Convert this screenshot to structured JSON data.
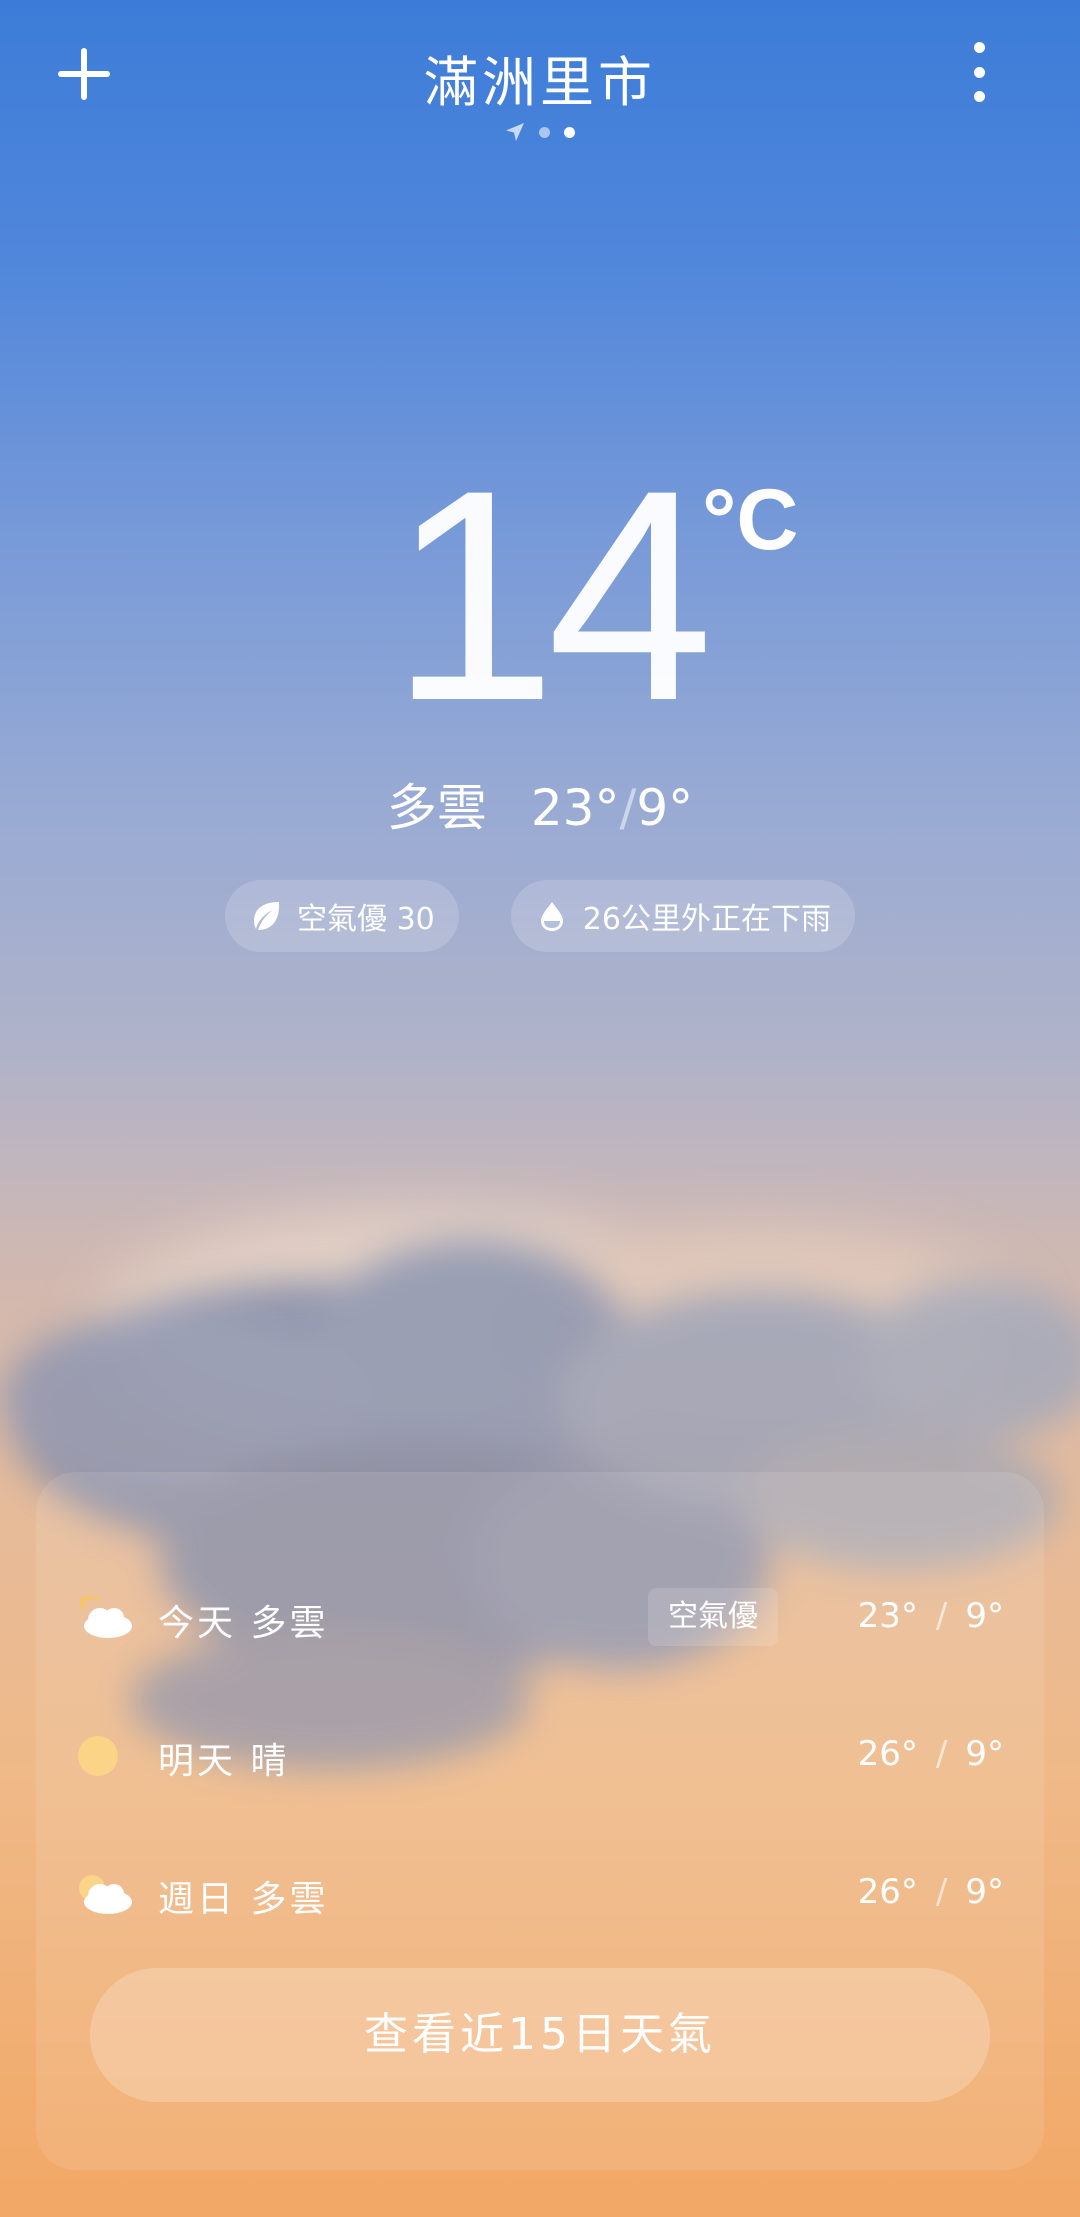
{
  "header": {
    "city": "滿洲里市",
    "page_indicator": {
      "count": 3,
      "active_index": 2,
      "first_is_location": true
    }
  },
  "current": {
    "temperature": "14",
    "unit": "°C",
    "condition": "多雲",
    "high": "23°",
    "low": "9°",
    "separator": "/"
  },
  "chips": [
    {
      "icon": "leaf-icon",
      "text": "空氣優 30"
    },
    {
      "icon": "raindrop-icon",
      "text": "26公里外正在下雨"
    }
  ],
  "forecast": {
    "rows": [
      {
        "icon": "partly-cloudy-night-icon",
        "label": "今天  多雲",
        "badge": "空氣優",
        "high": "23°",
        "low": "9°",
        "sep": "/"
      },
      {
        "icon": "sun-icon",
        "label": "明天  晴",
        "badge": "",
        "high": "26°",
        "low": "9°",
        "sep": "/"
      },
      {
        "icon": "partly-cloudy-icon",
        "label": "週日  多雲",
        "badge": "",
        "high": "26°",
        "low": "9°",
        "sep": "/"
      }
    ],
    "button_label": "查看近15日天氣"
  }
}
